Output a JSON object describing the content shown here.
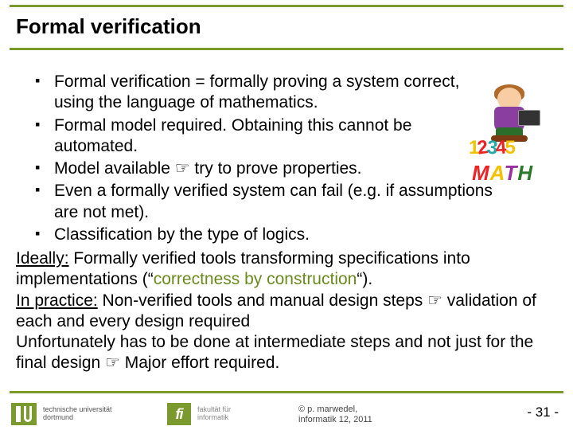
{
  "title": "Formal verification",
  "bullets": [
    "Formal verification = formally proving a system correct, using the language of mathematics.",
    "Formal model required. Obtaining this cannot be automated.",
    "Model available ☞ try to prove properties.",
    "Even a formally verified system can fail (e.g. if assumptions are not met).",
    "Classification by the type of logics."
  ],
  "p_ideally_label": "Ideally:",
  "p_ideally_1": " Formally verified tools transforming specifications into implementations (“",
  "p_ideally_green": "correctness by construction",
  "p_ideally_2": "“).",
  "p_practice_label": "In practice:",
  "p_practice_1": " Non-verified tools and manual design steps ☞ validation of each and every design required",
  "p_tail": "Unfortunately has to be done at intermediate steps and not just for the final design ☞ Major effort required.",
  "illus": {
    "n1": "1",
    "n2": "2",
    "n3": "3",
    "n4": "4",
    "n5": "5",
    "m1": "M",
    "m2": "A",
    "m3": "T",
    "m4": "H"
  },
  "footer": {
    "tu_line1": "technische universität",
    "tu_line2": "dortmund",
    "fi_mark": "fi",
    "fi_line1": "fakultät für",
    "fi_line2": "informatik",
    "copy_line1": "©  p. marwedel,",
    "copy_line2": "informatik 12,  2011",
    "page": "-  31 -"
  }
}
